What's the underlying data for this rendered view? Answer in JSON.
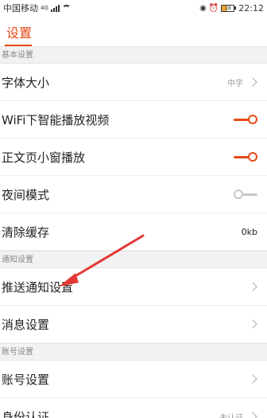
{
  "status_bar": {
    "carrier": "中国移动",
    "network": "4G",
    "battery": "18",
    "time": "22:12"
  },
  "header": {
    "title": "设置"
  },
  "sections": [
    {
      "title": "基本设置",
      "items": [
        {
          "label": "字体大小",
          "value": "中字",
          "control": "chevron"
        },
        {
          "label": "WiFi下智能播放视频",
          "control": "toggle",
          "state": "on"
        },
        {
          "label": "正文页小窗播放",
          "control": "toggle",
          "state": "on"
        },
        {
          "label": "夜间模式",
          "control": "toggle",
          "state": "off"
        },
        {
          "label": "清除缓存",
          "value": "0kb",
          "control": "value"
        }
      ]
    },
    {
      "title": "通知设置",
      "items": [
        {
          "label": "推送通知设置",
          "control": "chevron"
        },
        {
          "label": "消息设置",
          "control": "chevron"
        }
      ]
    },
    {
      "title": "账号设置",
      "items": [
        {
          "label": "账号设置",
          "control": "chevron"
        },
        {
          "label": "身份认证",
          "value": "未认证",
          "control": "chevron"
        }
      ]
    }
  ],
  "colors": {
    "accent": "#e64a19",
    "annotation": "#e53935"
  }
}
